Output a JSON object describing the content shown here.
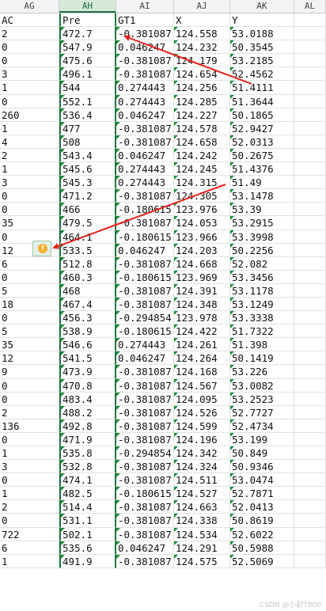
{
  "columns": [
    "AG",
    "AH",
    "AI",
    "AJ",
    "AK",
    "AL"
  ],
  "active_column": "AH",
  "header_row": [
    "AC",
    "Pre",
    "GT1",
    "X",
    "Y"
  ],
  "rows": [
    [
      "2",
      "472.7",
      "-0.381087",
      "124.558",
      "53.0188"
    ],
    [
      "0",
      "547.9",
      "0.046247",
      "124.232",
      "50.3545"
    ],
    [
      "0",
      "475.6",
      "-0.381087",
      "124.179",
      "53.2185"
    ],
    [
      "3",
      "496.1",
      "-0.381087",
      "124.654",
      "52.4562"
    ],
    [
      "1",
      "544",
      "0.274443",
      "124.256",
      "51.4111"
    ],
    [
      "0",
      "552.1",
      "0.274443",
      "124.285",
      "51.3644"
    ],
    [
      "260",
      "536.4",
      "0.046247",
      "124.227",
      "50.1865"
    ],
    [
      "1",
      "477",
      "-0.381087",
      "124.578",
      "52.9427"
    ],
    [
      "4",
      "508",
      "-0.381087",
      "124.658",
      "52.0313"
    ],
    [
      "2",
      "543.4",
      "0.046247",
      "124.242",
      "50.2675"
    ],
    [
      "1",
      "545.6",
      "0.274443",
      "124.245",
      "51.4376"
    ],
    [
      "3",
      "545.3",
      "0.274443",
      "124.315",
      "51.49"
    ],
    [
      "0",
      "471.2",
      "-0.381087",
      "124.305",
      "53.1478"
    ],
    [
      "0",
      "466",
      "-0.180615",
      "123.976",
      "53.39"
    ],
    [
      "35",
      "479.5",
      "-0.381087",
      "124.053",
      "53.2915"
    ],
    [
      "0",
      "464.1",
      "-0.180615",
      "123.966",
      "53.3998"
    ],
    [
      "12",
      "533.5",
      "0.046247",
      "124.203",
      "50.2256"
    ],
    [
      "6",
      "512.8",
      "-0.381087",
      "124.668",
      "52.082"
    ],
    [
      "0",
      "460.3",
      "-0.180615",
      "123.969",
      "53.3456"
    ],
    [
      "5",
      "468",
      "-0.381087",
      "124.391",
      "53.1178"
    ],
    [
      "18",
      "467.4",
      "-0.381087",
      "124.348",
      "53.1249"
    ],
    [
      "0",
      "456.3",
      "-0.294854",
      "123.978",
      "53.3338"
    ],
    [
      "5",
      "538.9",
      "-0.180615",
      "124.422",
      "51.7322"
    ],
    [
      "35",
      "546.6",
      "0.274443",
      "124.261",
      "51.398"
    ],
    [
      "12",
      "541.5",
      "0.046247",
      "124.264",
      "50.1419"
    ],
    [
      "9",
      "473.9",
      "-0.381087",
      "124.168",
      "53.226"
    ],
    [
      "0",
      "470.8",
      "-0.381087",
      "124.567",
      "53.0082"
    ],
    [
      "0",
      "483.4",
      "-0.381087",
      "124.095",
      "53.2523"
    ],
    [
      "2",
      "488.2",
      "-0.381087",
      "124.526",
      "52.7727"
    ],
    [
      "136",
      "492.8",
      "-0.381087",
      "124.599",
      "52.4734"
    ],
    [
      "0",
      "471.9",
      "-0.381087",
      "124.196",
      "53.199"
    ],
    [
      "1",
      "535.8",
      "-0.294854",
      "124.342",
      "50.849"
    ],
    [
      "3",
      "532.8",
      "-0.381087",
      "124.324",
      "50.9346"
    ],
    [
      "0",
      "474.1",
      "-0.381087",
      "124.511",
      "53.0474"
    ],
    [
      "1",
      "482.5",
      "-0.180615",
      "124.527",
      "52.7871"
    ],
    [
      "2",
      "514.4",
      "-0.381087",
      "124.663",
      "52.0413"
    ],
    [
      "0",
      "531.1",
      "-0.381087",
      "124.338",
      "50.8619"
    ],
    [
      "722",
      "502.1",
      "-0.381087",
      "124.534",
      "52.6022"
    ],
    [
      "6",
      "535.6",
      "0.046247",
      "124.291",
      "50.5988"
    ],
    [
      "1",
      "491.9",
      "-0.381087",
      "124.575",
      "52.5069"
    ]
  ],
  "warning_icon": "exclamation-warning-icon",
  "arrow_color": "#e8231d",
  "accent_color": "#217346",
  "watermark": "CSDN @小耐T800"
}
